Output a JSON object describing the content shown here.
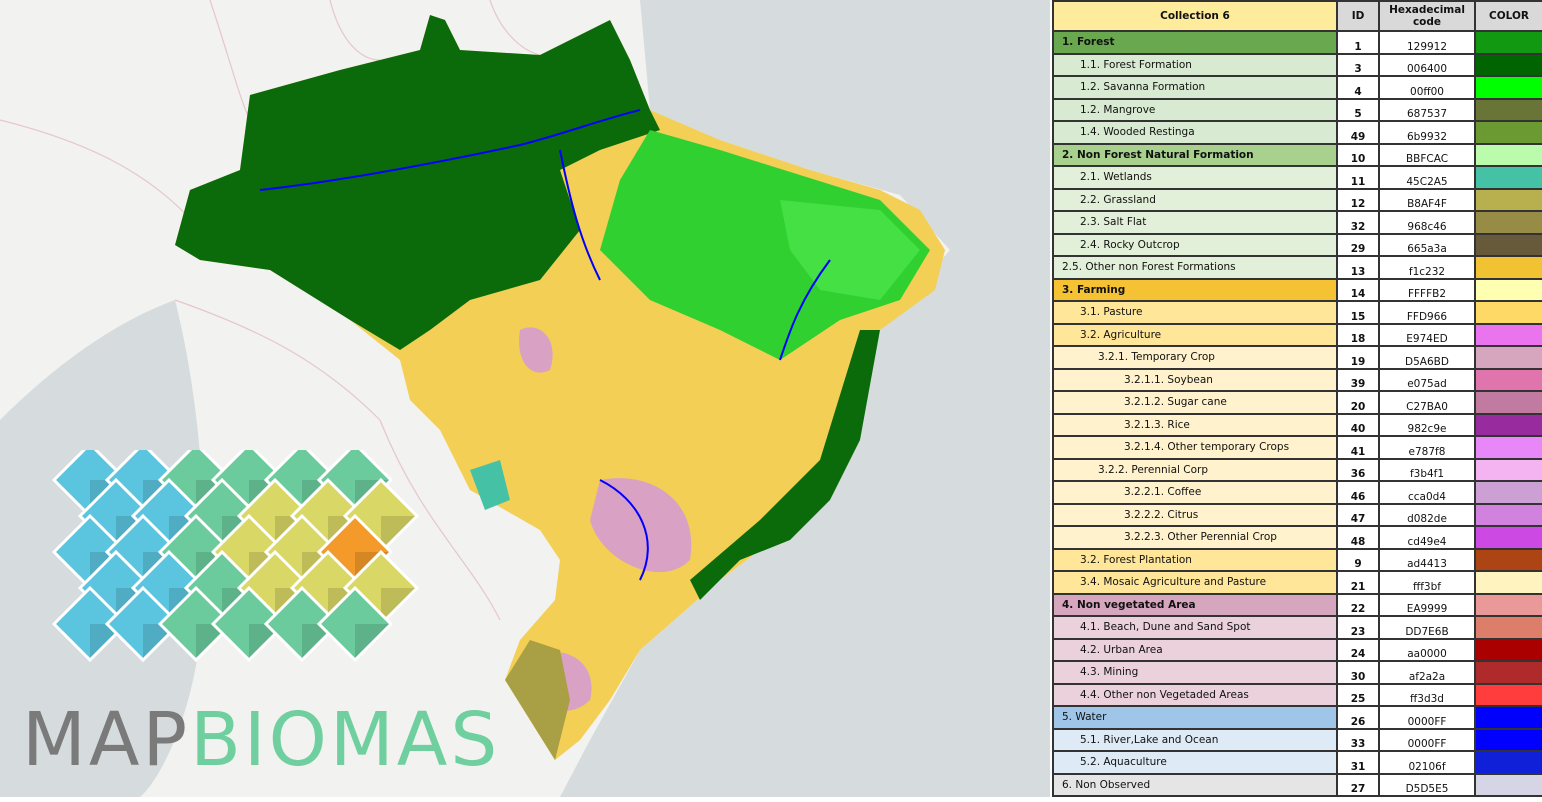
{
  "legend": {
    "headers": {
      "collection": "Collection 6",
      "id": "ID",
      "hex": "Hexadecimal code",
      "color": "COLOR"
    },
    "rows": [
      {
        "label": "1. Forest",
        "id": "1",
        "hex": "129912",
        "level": 0,
        "bold": true,
        "bg": "#6aa84f"
      },
      {
        "label": "1.1. Forest Formation",
        "id": "3",
        "hex": "006400",
        "level": 1,
        "bg": "#d9ead3"
      },
      {
        "label": "1.2. Savanna Formation",
        "id": "4",
        "hex": "00ff00",
        "level": 1,
        "bg": "#d9ead3"
      },
      {
        "label": "1.2. Mangrove",
        "id": "5",
        "hex": "687537",
        "level": 1,
        "bg": "#d9ead3"
      },
      {
        "label": "1.4. Wooded Restinga",
        "id": "49",
        "hex": "6b9932",
        "level": 1,
        "bg": "#d9ead3"
      },
      {
        "label": "2. Non Forest Natural Formation",
        "id": "10",
        "hex": "BBFCAC",
        "level": 0,
        "bold": true,
        "bg": "#a9d18e"
      },
      {
        "label": "2.1. Wetlands",
        "id": "11",
        "hex": "45C2A5",
        "level": 1,
        "bg": "#e2efd9"
      },
      {
        "label": "2.2. Grassland",
        "id": "12",
        "hex": "B8AF4F",
        "level": 1,
        "bg": "#e2efd9"
      },
      {
        "label": "2.3. Salt Flat",
        "id": "32",
        "hex": "968c46",
        "level": 1,
        "bg": "#e2efd9"
      },
      {
        "label": "2.4. Rocky Outcrop",
        "id": "29",
        "hex": "665a3a",
        "level": 1,
        "bg": "#e2efd9"
      },
      {
        "label": "2.5. Other non Forest Formations",
        "id": "13",
        "hex": "f1c232",
        "level": 0,
        "bg": "#e2efd9"
      },
      {
        "label": "3. Farming",
        "id": "14",
        "hex": "FFFFB2",
        "level": 0,
        "bold": true,
        "bg": "#f4c232"
      },
      {
        "label": "3.1. Pasture",
        "id": "15",
        "hex": "FFD966",
        "level": 1,
        "bg": "#ffe699"
      },
      {
        "label": "3.2. Agriculture",
        "id": "18",
        "hex": "E974ED",
        "level": 1,
        "bg": "#ffe699"
      },
      {
        "label": "3.2.1. Temporary Crop",
        "id": "19",
        "hex": "D5A6BD",
        "level": 2,
        "bg": "#fff2cc"
      },
      {
        "label": "3.2.1.1. Soybean",
        "id": "39",
        "hex": "e075ad",
        "level": 3,
        "bg": "#fff2cc"
      },
      {
        "label": "3.2.1.2. Sugar cane",
        "id": "20",
        "hex": "C27BA0",
        "level": 3,
        "bg": "#fff2cc"
      },
      {
        "label": "3.2.1.3. Rice",
        "id": "40",
        "hex": "982c9e",
        "level": 3,
        "bg": "#fff2cc"
      },
      {
        "label": "3.2.1.4. Other temporary Crops",
        "id": "41",
        "hex": "e787f8",
        "level": 3,
        "bg": "#fff2cc"
      },
      {
        "label": "3.2.2. Perennial Corp",
        "id": "36",
        "hex": "f3b4f1",
        "level": 2,
        "bg": "#fff2cc"
      },
      {
        "label": "3.2.2.1. Coffee",
        "id": "46",
        "hex": "cca0d4",
        "level": 3,
        "bg": "#fff2cc"
      },
      {
        "label": "3.2.2.2. Citrus",
        "id": "47",
        "hex": "d082de",
        "level": 3,
        "bg": "#fff2cc"
      },
      {
        "label": "3.2.2.3. Other Perennial Crop",
        "id": "48",
        "hex": "cd49e4",
        "level": 3,
        "bg": "#fff2cc"
      },
      {
        "label": "3.2. Forest Plantation",
        "id": "9",
        "hex": "ad4413",
        "level": 1,
        "bg": "#ffe699"
      },
      {
        "label": "3.4. Mosaic Agriculture and Pasture",
        "id": "21",
        "hex": "fff3bf",
        "level": 1,
        "bg": "#ffe699"
      },
      {
        "label": "4. Non vegetated Area",
        "id": "22",
        "hex": "EA9999",
        "level": 0,
        "bold": true,
        "bg": "#d5a6bd"
      },
      {
        "label": "4.1. Beach, Dune and Sand Spot",
        "id": "23",
        "hex": "DD7E6B",
        "level": 1,
        "bg": "#ead1dc"
      },
      {
        "label": "4.2. Urban Area",
        "id": "24",
        "hex": "aa0000",
        "level": 1,
        "bg": "#ead1dc"
      },
      {
        "label": "4.3. Mining",
        "id": "30",
        "hex": "af2a2a",
        "level": 1,
        "bg": "#ead1dc"
      },
      {
        "label": "4.4. Other non Vegetaded Areas",
        "id": "25",
        "hex": "ff3d3d",
        "level": 1,
        "bg": "#ead1dc"
      },
      {
        "label": "5. Water",
        "id": "26",
        "hex": "0000FF",
        "level": 0,
        "bg": "#9fc5e8"
      },
      {
        "label": "5.1. River,Lake and Ocean",
        "id": "33",
        "hex": "0000FF",
        "level": 1,
        "bg": "#deebf7"
      },
      {
        "label": "5.2. Aquaculture",
        "id": "31",
        "hex": "02106f",
        "level": 1,
        "bg": "#deebf7"
      },
      {
        "label": "6. Non Observed",
        "id": "27",
        "hex": "D5D5E5",
        "level": 0,
        "bg": "#e5e5e5"
      }
    ],
    "swatch_overrides": {
      "129912": "#129912",
      "02106f": "#1020d8"
    }
  },
  "logo": {
    "part1": "MAP",
    "part2": "BIOMAS"
  }
}
